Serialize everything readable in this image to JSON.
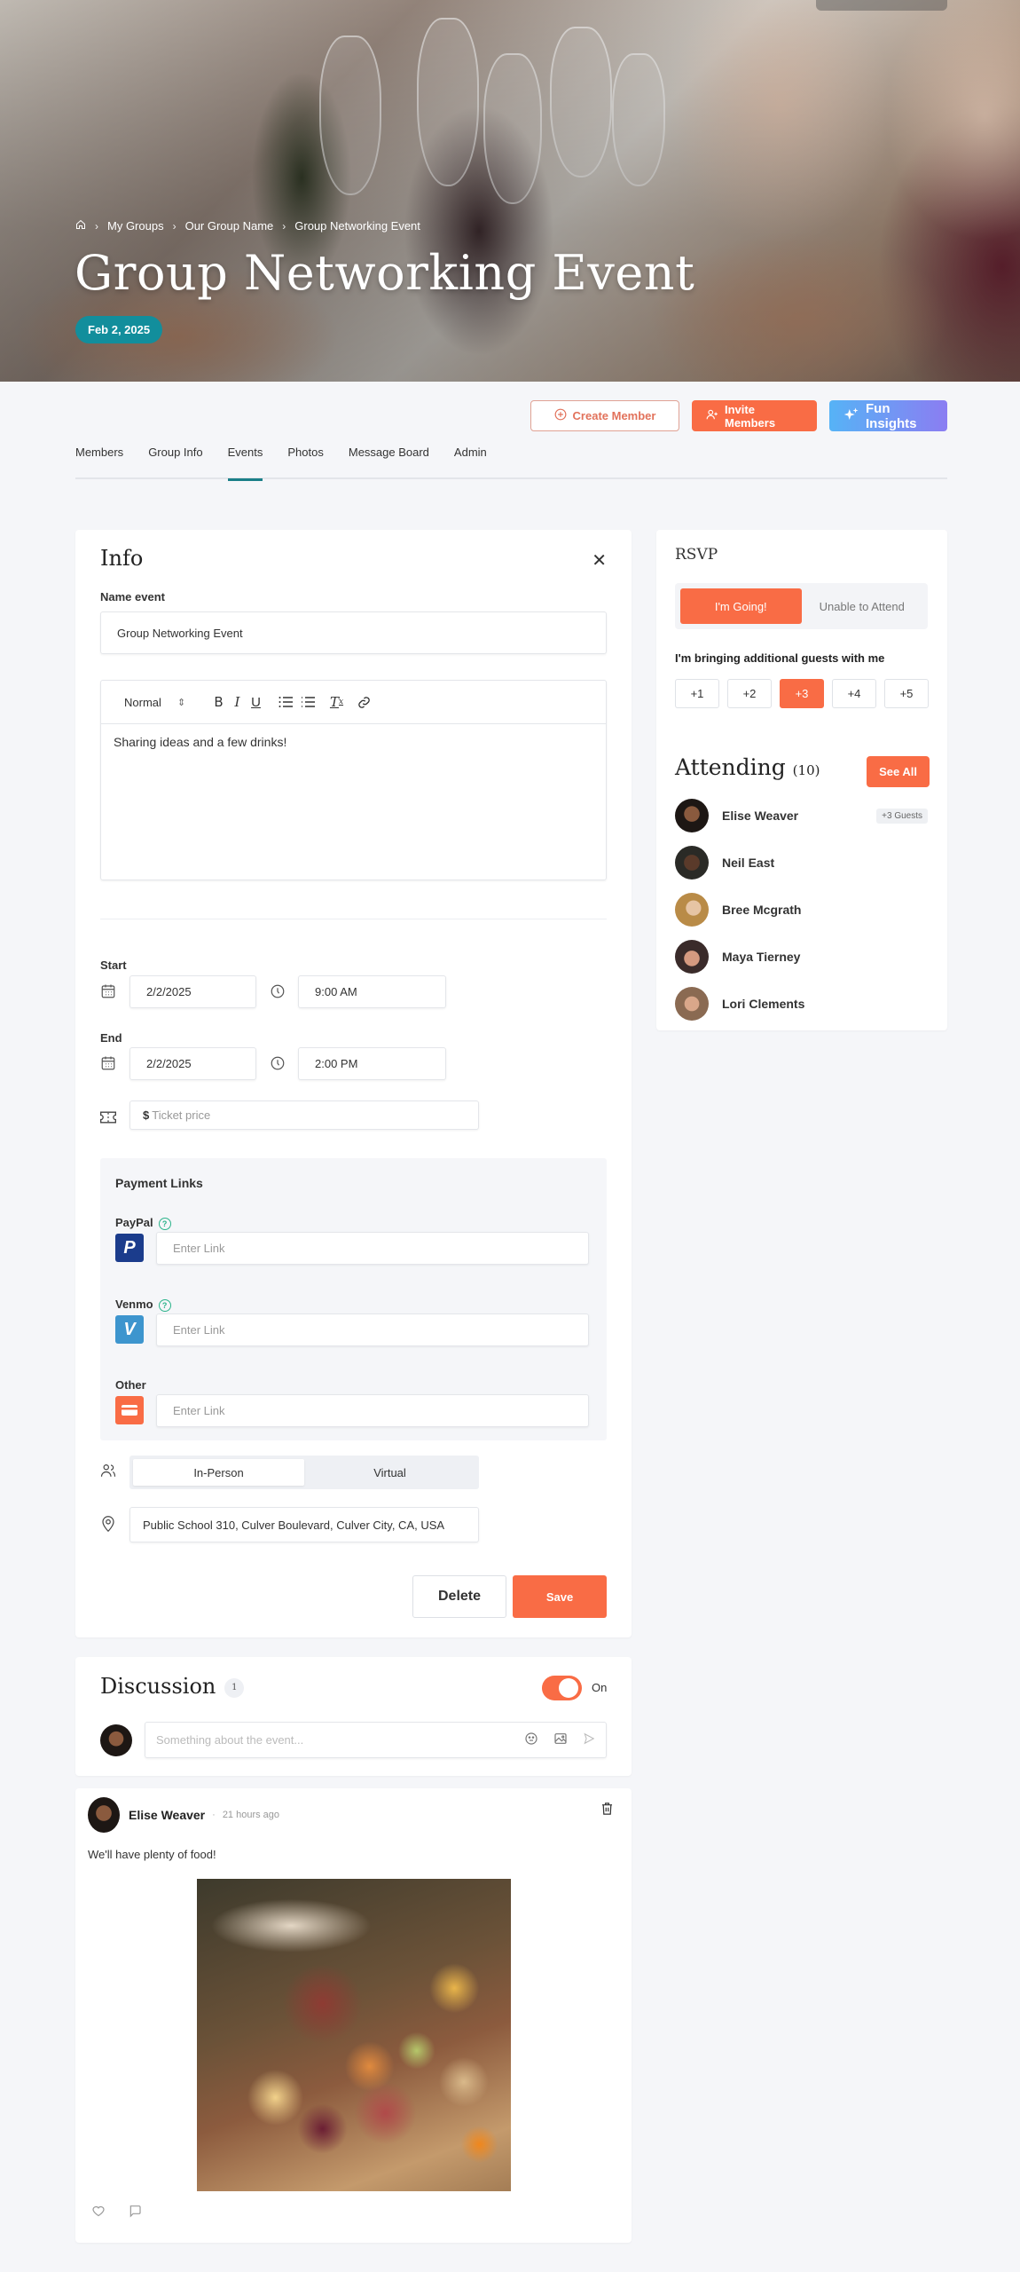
{
  "hero": {
    "breadcrumb": [
      "My Groups",
      "Our Group Name",
      "Group Networking Event"
    ],
    "title": "Group Networking Event",
    "date_badge": "Feb 2, 2025"
  },
  "actions": {
    "create_member": "Create Member",
    "invite_members": "Invite Members",
    "fun_insights": "Fun Insights"
  },
  "tabs": [
    {
      "label": "Members",
      "active": false
    },
    {
      "label": "Group Info",
      "active": false
    },
    {
      "label": "Events",
      "active": true
    },
    {
      "label": "Photos",
      "active": false
    },
    {
      "label": "Message Board",
      "active": false
    },
    {
      "label": "Admin",
      "active": false
    }
  ],
  "info": {
    "title": "Info",
    "name_label": "Name event",
    "name_value": "Group Networking Event",
    "editor": {
      "format": "Normal",
      "body": "Sharing ideas and a few drinks!"
    },
    "start_label": "Start",
    "start_date": "2/2/2025",
    "start_time": "9:00 AM",
    "end_label": "End",
    "end_date": "2/2/2025",
    "end_time": "2:00 PM",
    "ticket_prefix": "$",
    "ticket_placeholder": "Ticket price",
    "payment": {
      "title": "Payment Links",
      "items": [
        {
          "label": "PayPal",
          "placeholder": "Enter Link",
          "logo": "P",
          "color": "#1b3c8c",
          "help": true
        },
        {
          "label": "Venmo",
          "placeholder": "Enter Link",
          "logo": "V",
          "color": "#3d95ce",
          "help": true
        },
        {
          "label": "Other",
          "placeholder": "Enter Link",
          "logo": "card",
          "color": "#f96c45",
          "help": false
        }
      ],
      "help_glyph": "?"
    },
    "mode_options": [
      {
        "label": "In-Person",
        "active": true
      },
      {
        "label": "Virtual",
        "active": false
      }
    ],
    "location": "Public School 310, Culver Boulevard, Culver City, CA, USA",
    "delete_label": "Delete",
    "save_label": "Save"
  },
  "rsvp": {
    "title": "RSVP",
    "going_label": "I'm Going!",
    "unable_label": "Unable to Attend",
    "guests_label": "I'm bringing additional guests with me",
    "guest_options": [
      "+1",
      "+2",
      "+3",
      "+4",
      "+5"
    ],
    "selected_guests": "+3",
    "attending_title": "Attending",
    "attending_count": "(10)",
    "see_all": "See All",
    "attendees": [
      {
        "name": "Elise Weaver",
        "guests": "+3 Guests"
      },
      {
        "name": "Neil East",
        "guests": null
      },
      {
        "name": "Bree Mcgrath",
        "guests": null
      },
      {
        "name": "Maya Tierney",
        "guests": null
      },
      {
        "name": "Lori Clements",
        "guests": null
      }
    ]
  },
  "discussion": {
    "title": "Discussion",
    "count": "1",
    "toggle_label": "On",
    "toggle_on": true,
    "input_placeholder": "Something about the event..."
  },
  "post": {
    "author": "Elise Weaver",
    "dot": "·",
    "time": "21 hours ago",
    "text": "We'll have plenty of food!"
  },
  "colors": {
    "accent": "#f96c45",
    "teal": "#128e9c",
    "tab_underline": "#1a7f88",
    "help_green": "#2bb38a"
  }
}
